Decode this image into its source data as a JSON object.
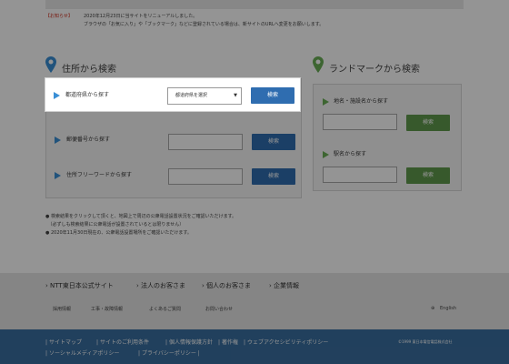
{
  "notice": {
    "tag": "【お知らせ】",
    "line1": "2020年12月23日に当サイトをリニューアルしました。",
    "line2": "ブラウザの「お気に入り」や「ブックマーク」などに登録されている場合は、新サイトのURLへ変更をお願いします。"
  },
  "address_search": {
    "title": "住所から検索",
    "prefecture": {
      "label": "都道府県から探す",
      "select_value": "都道府県を選択",
      "button": "検索"
    },
    "postal": {
      "label": "郵便番号から探す",
      "button": "検索"
    },
    "freeword": {
      "label": "住所フリーワードから探す",
      "button": "検索"
    }
  },
  "landmark_search": {
    "title": "ランドマークから検索",
    "place": {
      "label": "地名・施設名から探す",
      "button": "検索"
    },
    "station": {
      "label": "駅名から探す",
      "button": "検索"
    }
  },
  "notes": [
    "● 検索結果をクリックして頂くと、地図上で周辺の公衆電話設置状況をご確認いただけます。",
    "　（必ずしも検索結果に公衆電話が設置されているとは限りません）",
    "● 2020年11月30日現在の、公衆電話設置場所をご確認いただけます。"
  ],
  "footer": {
    "main_links": [
      "NTT東日本公式サイト",
      "法人のお客さま",
      "個人のお客さま",
      "企業情報"
    ],
    "sub_links": [
      "採用情報",
      "工事・故障情報",
      "よくあるご質問",
      "お問い合わせ"
    ],
    "english": "English",
    "bottom_links_row1": [
      "サイトマップ",
      "サイトのご利用条件",
      "個人情報保護方針",
      "著作権",
      "ウェブアクセシビリティポリシー"
    ],
    "bottom_links_row2": [
      "ソーシャルメディアポリシー",
      "プライバシーポリシー"
    ],
    "copyright": "©1999 東日本電信電話株式会社"
  },
  "colors": {
    "blue_button": "#2f6db0",
    "green_button": "#5f9a4c",
    "footer_bottom": "#3a6fa0",
    "notice_red": "#d0301e"
  }
}
